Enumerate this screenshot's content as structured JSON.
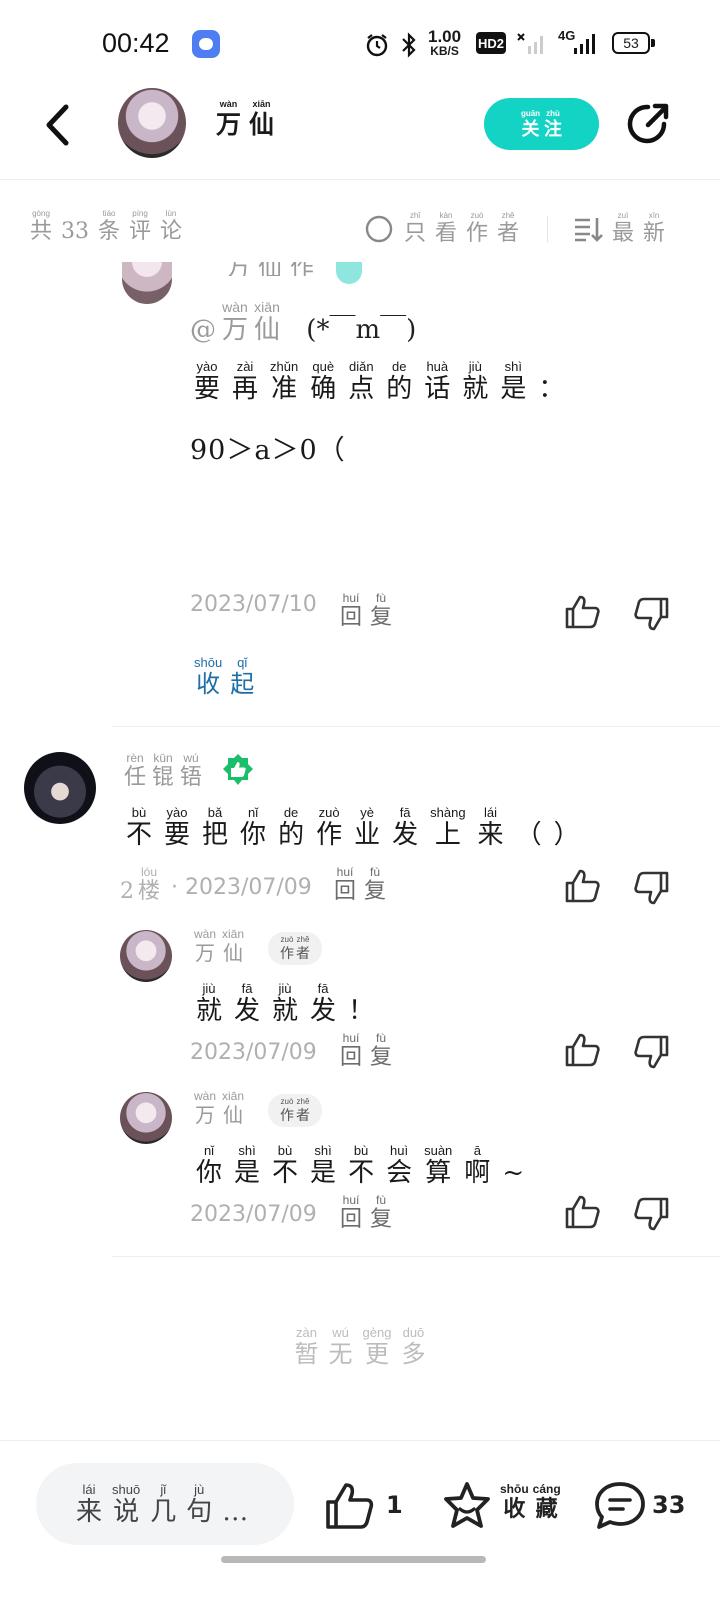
{
  "status_bar": {
    "time": "00:42",
    "net_speed_value": "1.00",
    "net_speed_unit": "KB/S",
    "hd_label": "HD2",
    "signal_label": "4G",
    "battery": "53"
  },
  "header": {
    "author_name": [
      {
        "py": "wàn",
        "hz": "万"
      },
      {
        "py": "xiān",
        "hz": "仙"
      }
    ],
    "follow": [
      {
        "py": "guān",
        "hz": "关"
      },
      {
        "py": "zhù",
        "hz": "注"
      }
    ]
  },
  "filter": {
    "total": [
      {
        "py": "gòng",
        "hz": "共"
      },
      {
        "py": "",
        "hz": "33"
      },
      {
        "py": "tiáo",
        "hz": "条"
      },
      {
        "py": "píng",
        "hz": "评"
      },
      {
        "py": "lùn",
        "hz": "论"
      }
    ],
    "only_author": [
      {
        "py": "zhǐ",
        "hz": "只"
      },
      {
        "py": "kàn",
        "hz": "看"
      },
      {
        "py": "zuò",
        "hz": "作"
      },
      {
        "py": "zhě",
        "hz": "者"
      }
    ],
    "latest": [
      {
        "py": "zuì",
        "hz": "最"
      },
      {
        "py": "xīn",
        "hz": "新"
      }
    ]
  },
  "reply1": {
    "mention": [
      {
        "py": "",
        "hz": "@"
      },
      {
        "py": "wàn",
        "hz": "万"
      },
      {
        "py": "xiān",
        "hz": "仙"
      }
    ],
    "emoticon": "(*￣m￣)",
    "line1": [
      {
        "py": "yào",
        "hz": "要"
      },
      {
        "py": "zài",
        "hz": "再"
      },
      {
        "py": "zhǔn",
        "hz": "准"
      },
      {
        "py": "què",
        "hz": "确"
      },
      {
        "py": "diǎn",
        "hz": "点"
      },
      {
        "py": "de",
        "hz": "的"
      },
      {
        "py": "huà",
        "hz": "话"
      },
      {
        "py": "jiù",
        "hz": "就"
      },
      {
        "py": "shì",
        "hz": "是"
      },
      {
        "py": "",
        "hz": "："
      }
    ],
    "line2": "90＞a＞0（",
    "date": "2023/07/10",
    "reply": [
      {
        "py": "huí",
        "hz": "回"
      },
      {
        "py": "fù",
        "hz": "复"
      }
    ],
    "collapse": [
      {
        "py": "shōu",
        "hz": "收"
      },
      {
        "py": "qǐ",
        "hz": "起"
      }
    ]
  },
  "comment2": {
    "user": [
      {
        "py": "rèn",
        "hz": "任"
      },
      {
        "py": "kūn",
        "hz": "锟"
      },
      {
        "py": "wú",
        "hz": "铻"
      }
    ],
    "text": [
      {
        "py": "bù",
        "hz": "不"
      },
      {
        "py": "yào",
        "hz": "要"
      },
      {
        "py": "bǎ",
        "hz": "把"
      },
      {
        "py": "nǐ",
        "hz": "你"
      },
      {
        "py": "de",
        "hz": "的"
      },
      {
        "py": "zuò",
        "hz": "作"
      },
      {
        "py": "yè",
        "hz": "业"
      },
      {
        "py": "fā",
        "hz": "发"
      },
      {
        "py": "shàng",
        "hz": "上"
      },
      {
        "py": "lái",
        "hz": "来"
      },
      {
        "py": "",
        "hz": "（"
      },
      {
        "py": "",
        "hz": "）"
      }
    ],
    "floor": [
      {
        "py": "",
        "hz": "2"
      },
      {
        "py": "lóu",
        "hz": "楼"
      }
    ],
    "date": "· 2023/07/09",
    "reply": [
      {
        "py": "huí",
        "hz": "回"
      },
      {
        "py": "fù",
        "hz": "复"
      }
    ]
  },
  "sub1": {
    "user": [
      {
        "py": "wàn",
        "hz": "万"
      },
      {
        "py": "xiān",
        "hz": "仙"
      }
    ],
    "tag": [
      {
        "py": "zuò",
        "hz": "作"
      },
      {
        "py": "zhě",
        "hz": "者"
      }
    ],
    "text": [
      {
        "py": "jiù",
        "hz": "就"
      },
      {
        "py": "fā",
        "hz": "发"
      },
      {
        "py": "jiù",
        "hz": "就"
      },
      {
        "py": "fā",
        "hz": "发"
      },
      {
        "py": "",
        "hz": "！"
      }
    ],
    "date": "2023/07/09",
    "reply": [
      {
        "py": "huí",
        "hz": "回"
      },
      {
        "py": "fù",
        "hz": "复"
      }
    ]
  },
  "sub2": {
    "user": [
      {
        "py": "wàn",
        "hz": "万"
      },
      {
        "py": "xiān",
        "hz": "仙"
      }
    ],
    "tag": [
      {
        "py": "zuò",
        "hz": "作"
      },
      {
        "py": "zhě",
        "hz": "者"
      }
    ],
    "text": [
      {
        "py": "nǐ",
        "hz": "你"
      },
      {
        "py": "shì",
        "hz": "是"
      },
      {
        "py": "bù",
        "hz": "不"
      },
      {
        "py": "shì",
        "hz": "是"
      },
      {
        "py": "bù",
        "hz": "不"
      },
      {
        "py": "huì",
        "hz": "会"
      },
      {
        "py": "suàn",
        "hz": "算"
      },
      {
        "py": "ā",
        "hz": "啊"
      },
      {
        "py": "",
        "hz": "~"
      }
    ],
    "date": "2023/07/09",
    "reply": [
      {
        "py": "huí",
        "hz": "回"
      },
      {
        "py": "fù",
        "hz": "复"
      }
    ]
  },
  "no_more": [
    {
      "py": "zàn",
      "hz": "暂"
    },
    {
      "py": "wú",
      "hz": "无"
    },
    {
      "py": "gèng",
      "hz": "更"
    },
    {
      "py": "duō",
      "hz": "多"
    }
  ],
  "bottom": {
    "input_placeholder": [
      {
        "py": "lái",
        "hz": "来"
      },
      {
        "py": "shuō",
        "hz": "说"
      },
      {
        "py": "jǐ",
        "hz": "几"
      },
      {
        "py": "jù",
        "hz": "句"
      },
      {
        "py": "",
        "hz": "…"
      }
    ],
    "like_count": "1",
    "favorite": [
      {
        "py": "shōu",
        "hz": "收"
      },
      {
        "py": "cáng",
        "hz": "藏"
      }
    ],
    "comment_count": "33"
  },
  "colors": {
    "accent_teal": "#12d3c4",
    "badge_green": "#1bbf6b",
    "link_blue": "#1c6fa8",
    "meta_gray": "#9a9a9a"
  },
  "icons": [
    "back-arrow-icon",
    "share-icon",
    "radio-circle-icon",
    "sort-icon",
    "thumbs-up-icon",
    "thumbs-down-icon",
    "badge-like-icon",
    "star-icon",
    "chat-bubble-icon",
    "alarm-icon",
    "bluetooth-icon",
    "battery-icon"
  ]
}
